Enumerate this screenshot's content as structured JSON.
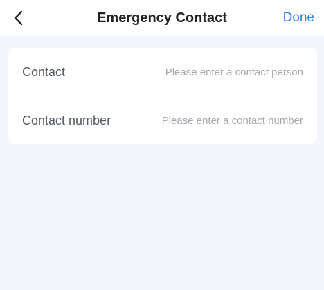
{
  "header": {
    "back_icon": "chevron-left-icon",
    "title": "Emergency Contact",
    "done_label": "Done",
    "accent_color": "#2f80ed"
  },
  "form": {
    "fields": [
      {
        "label": "Contact",
        "value": "",
        "placeholder": "Please enter a contact person"
      },
      {
        "label": "Contact number",
        "value": "",
        "placeholder": "Please enter a contact number"
      }
    ]
  }
}
